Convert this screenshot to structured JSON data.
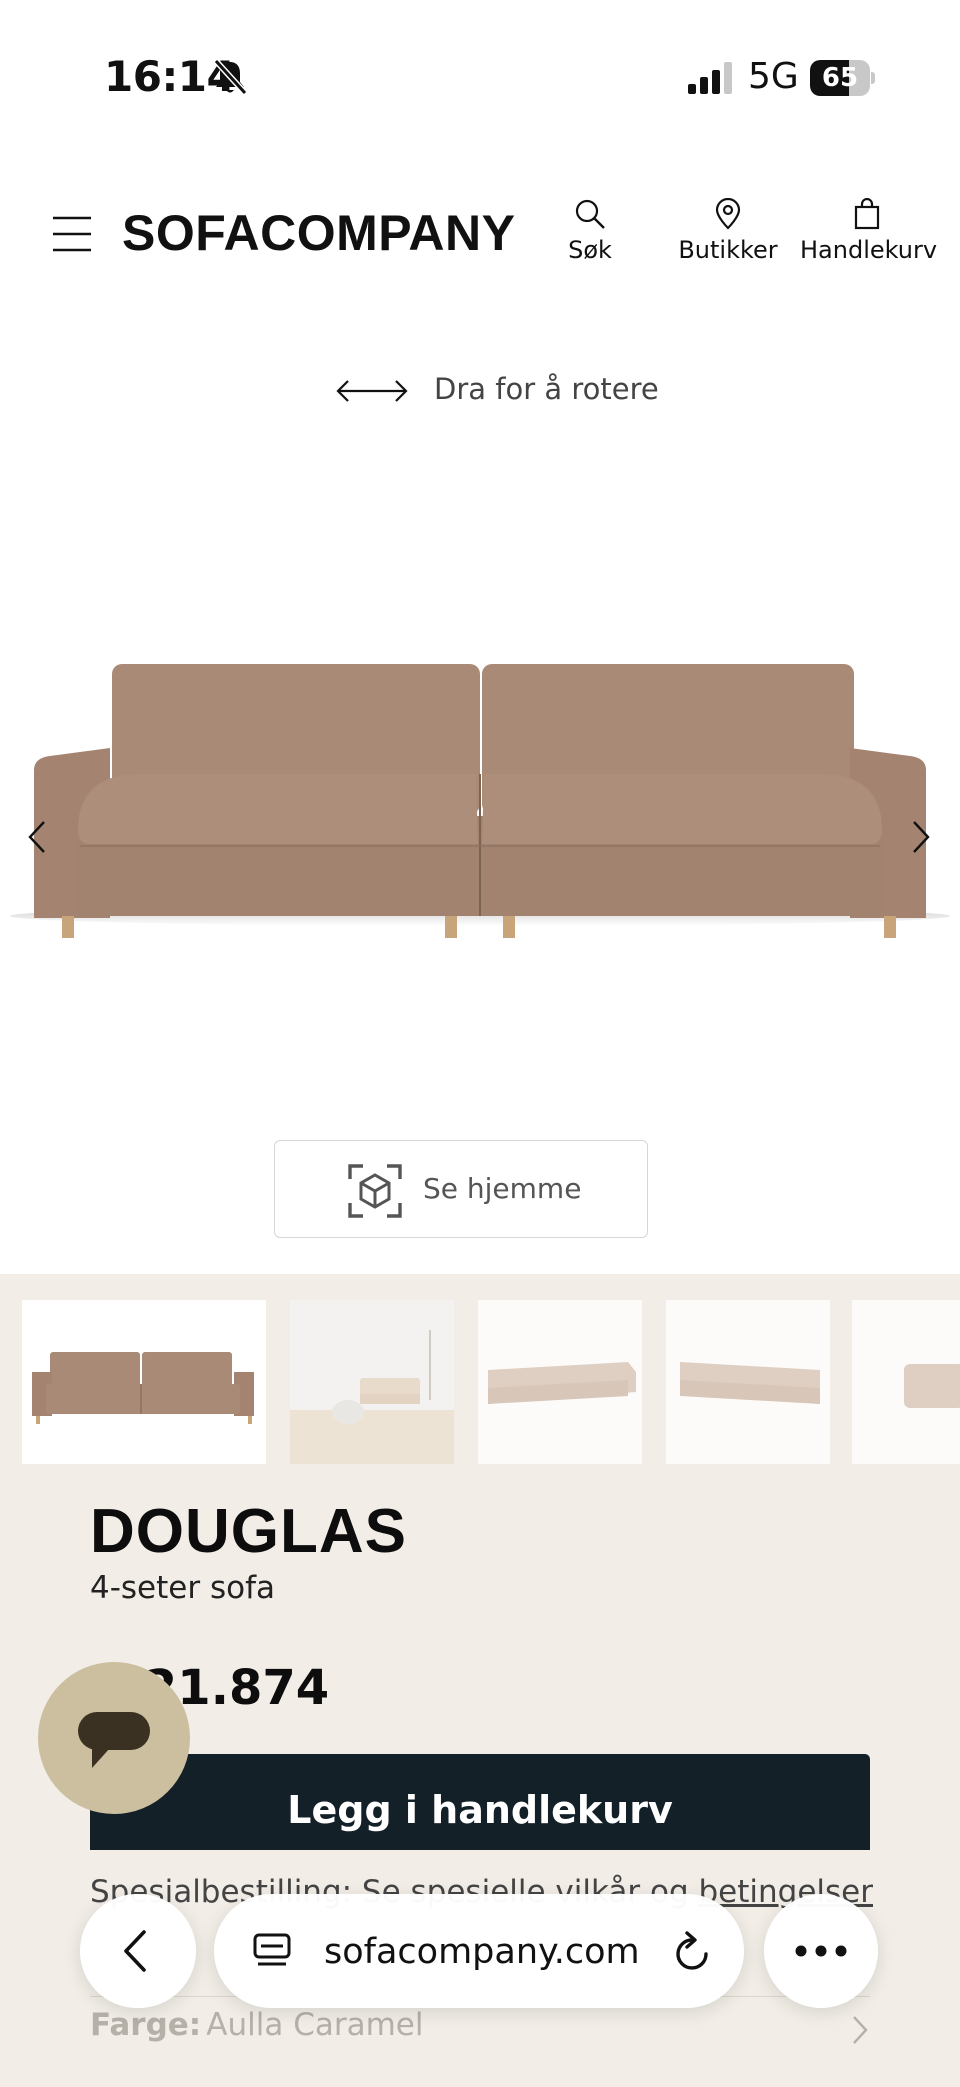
{
  "status_bar": {
    "time": "16:14",
    "network": "5G",
    "battery": "65",
    "battery_level": 0.65,
    "silent_icon": "bell-slash-icon",
    "signal_icon": "signal-bars-icon"
  },
  "header": {
    "logo": "SOFACOMPANY",
    "menu_icon": "hamburger-menu-icon",
    "search_label": "Søk",
    "stores_label": "Butikker",
    "cart_label": "Handlekurv"
  },
  "viewer": {
    "rotate_hint": "Dra for å rotere",
    "ar_button_label": "Se hjemme"
  },
  "thumbnails": [
    {
      "name": "front-view",
      "selected": true
    },
    {
      "name": "room-scene",
      "selected": false
    },
    {
      "name": "angle-left",
      "selected": false
    },
    {
      "name": "angle-right",
      "selected": false
    },
    {
      "name": "side-view",
      "selected": false
    }
  ],
  "product": {
    "name": "DOUGLAS",
    "subtitle": "4-seter sofa",
    "price": "K 21.874",
    "price_sub": "...",
    "add_to_cart": "Legg i handlekurv",
    "special_order_prefix": "Spesialbestilling: Se spesielle vilkår og ",
    "special_order_link": "betingelser",
    "color_label": "Farge:",
    "color_value": "Aulla Caramel"
  },
  "browser": {
    "url": "sofacompany.com"
  },
  "colors": {
    "sofa": "#a88874",
    "info_bg": "#f2eee7",
    "cta_bg": "#142028",
    "chat_bg": "#cbbf9f"
  }
}
